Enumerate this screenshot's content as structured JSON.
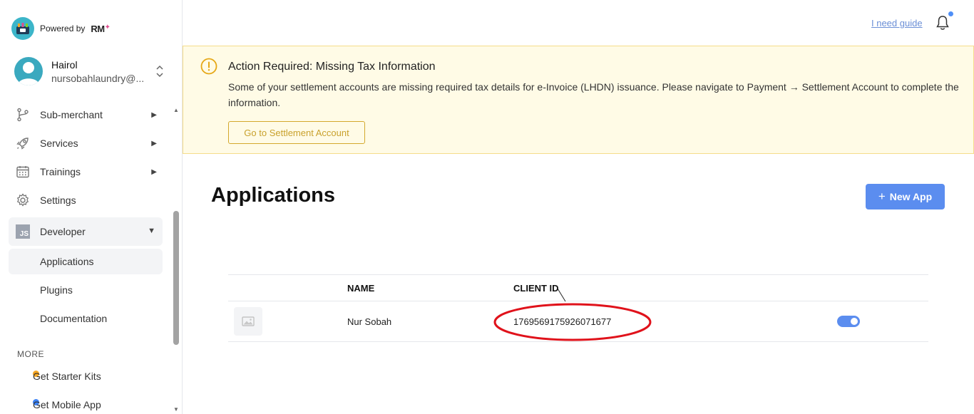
{
  "brand": {
    "powered_by": "Powered by",
    "mark": "RM"
  },
  "user": {
    "name": "Hairol",
    "email": "nursobahlaundry@..."
  },
  "sidebar": {
    "items": [
      {
        "label": "Sub-merchant",
        "icon": "branch-icon"
      },
      {
        "label": "Services",
        "icon": "rocket-icon"
      },
      {
        "label": "Trainings",
        "icon": "calendar-icon"
      },
      {
        "label": "Settings",
        "icon": "gear-icon"
      }
    ],
    "developer": {
      "label": "Developer",
      "icon_text": "JS"
    },
    "sub_items": [
      {
        "label": "Applications"
      },
      {
        "label": "Plugins"
      },
      {
        "label": "Documentation"
      }
    ],
    "more_label": "MORE",
    "more_items": [
      {
        "label": "Get Starter Kits",
        "color": "#f5a623"
      },
      {
        "label": "Get Mobile App",
        "color": "#3b82f6"
      }
    ]
  },
  "topbar": {
    "guide_label": "I need guide"
  },
  "alert": {
    "title": "Action Required: Missing Tax Information",
    "body": "Some of your settlement accounts are missing required tax details for e-Invoice (LHDN) issuance. Please navigate to Payment → Settlement Account to complete the information.",
    "button_label": "Go to Settlement Account"
  },
  "main": {
    "title": "Applications",
    "new_app_label": "New App",
    "table": {
      "columns": [
        "NAME",
        "CLIENT ID"
      ],
      "rows": [
        {
          "name": "Nur Sobah",
          "client_id": "1769569175926071677",
          "enabled": true
        }
      ]
    }
  },
  "colors": {
    "accent": "#5b8def",
    "alert_bg": "#fffbe6",
    "annotation": "#e0121b"
  }
}
